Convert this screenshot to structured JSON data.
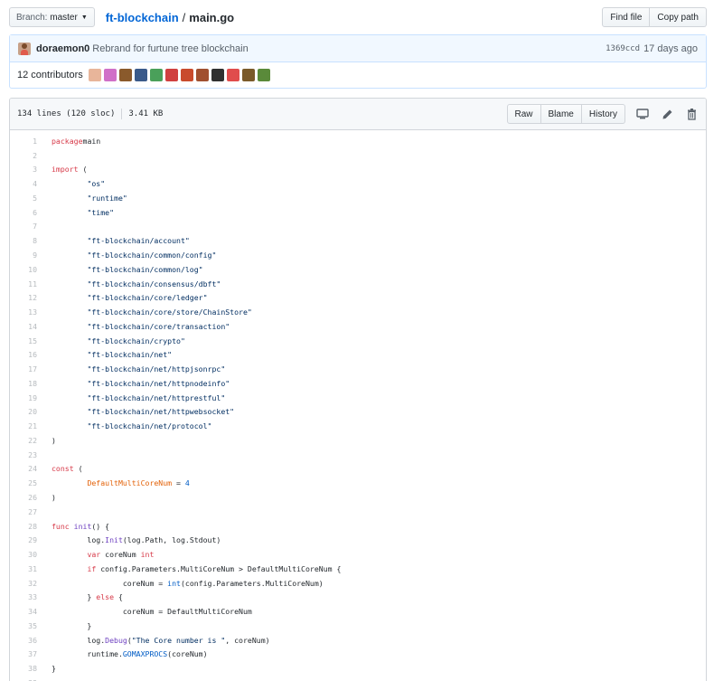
{
  "topbar": {
    "branch_prefix": "Branch:",
    "branch_name": "master",
    "repo_name": "ft-blockchain",
    "separator": "/",
    "file_name": "main.go",
    "find_file_label": "Find file",
    "copy_path_label": "Copy path"
  },
  "commit": {
    "author": "doraemon0",
    "message": "Rebrand for furtune tree blockchain",
    "sha": "1369ccd",
    "age": "17 days ago",
    "contributors_label": "12 contributors",
    "contributor_avatars": [
      "#e8b59a",
      "#d070c8",
      "#8a5a2c",
      "#3a5a8a",
      "#4aa05a",
      "#d04040",
      "#c94b2d",
      "#a05030",
      "#303030",
      "#e04c4c",
      "#7a5a2a",
      "#5a8a3a"
    ]
  },
  "file": {
    "lines_info": "134 lines (120 sloc)",
    "size_info": "3.41 KB",
    "raw_label": "Raw",
    "blame_label": "Blame",
    "history_label": "History",
    "icons": [
      "desktop-icon",
      "pencil-icon",
      "trash-icon"
    ]
  },
  "code_lines": [
    [
      [
        "kw",
        "package"
      ],
      [
        "",
        "main"
      ]
    ],
    [],
    [
      [
        "kw",
        "import"
      ],
      [
        "",
        " ("
      ]
    ],
    [
      [
        "",
        "        "
      ],
      [
        "st",
        "\"os\""
      ]
    ],
    [
      [
        "",
        "        "
      ],
      [
        "st",
        "\"runtime\""
      ]
    ],
    [
      [
        "",
        "        "
      ],
      [
        "st",
        "\"time\""
      ]
    ],
    [],
    [
      [
        "",
        "        "
      ],
      [
        "st",
        "\"ft-blockchain/account\""
      ]
    ],
    [
      [
        "",
        "        "
      ],
      [
        "st",
        "\"ft-blockchain/common/config\""
      ]
    ],
    [
      [
        "",
        "        "
      ],
      [
        "st",
        "\"ft-blockchain/common/log\""
      ]
    ],
    [
      [
        "",
        "        "
      ],
      [
        "st",
        "\"ft-blockchain/consensus/dbft\""
      ]
    ],
    [
      [
        "",
        "        "
      ],
      [
        "st",
        "\"ft-blockchain/core/ledger\""
      ]
    ],
    [
      [
        "",
        "        "
      ],
      [
        "st",
        "\"ft-blockchain/core/store/ChainStore\""
      ]
    ],
    [
      [
        "",
        "        "
      ],
      [
        "st",
        "\"ft-blockchain/core/transaction\""
      ]
    ],
    [
      [
        "",
        "        "
      ],
      [
        "st",
        "\"ft-blockchain/crypto\""
      ]
    ],
    [
      [
        "",
        "        "
      ],
      [
        "st",
        "\"ft-blockchain/net\""
      ]
    ],
    [
      [
        "",
        "        "
      ],
      [
        "st",
        "\"ft-blockchain/net/httpjsonrpc\""
      ]
    ],
    [
      [
        "",
        "        "
      ],
      [
        "st",
        "\"ft-blockchain/net/httpnodeinfo\""
      ]
    ],
    [
      [
        "",
        "        "
      ],
      [
        "st",
        "\"ft-blockchain/net/httprestful\""
      ]
    ],
    [
      [
        "",
        "        "
      ],
      [
        "st",
        "\"ft-blockchain/net/httpwebsocket\""
      ]
    ],
    [
      [
        "",
        "        "
      ],
      [
        "st",
        "\"ft-blockchain/net/protocol\""
      ]
    ],
    [
      [
        "",
        ")"
      ]
    ],
    [],
    [
      [
        "kw",
        "const"
      ],
      [
        "",
        " ("
      ]
    ],
    [
      [
        "",
        "        "
      ],
      [
        "cn",
        "DefaultMultiCoreNum"
      ],
      [
        "",
        " = "
      ],
      [
        "nm",
        "4"
      ]
    ],
    [
      [
        "",
        ")"
      ]
    ],
    [],
    [
      [
        "kw",
        "func"
      ],
      [
        "",
        " "
      ],
      [
        "fn",
        "init"
      ],
      [
        "",
        "() {"
      ]
    ],
    [
      [
        "",
        "        log."
      ],
      [
        "fn",
        "Init"
      ],
      [
        "",
        "(log.Path, log.Stdout)"
      ]
    ],
    [
      [
        "",
        "        "
      ],
      [
        "kw",
        "var"
      ],
      [
        "",
        " coreNum "
      ],
      [
        "kw",
        "int"
      ]
    ],
    [
      [
        "",
        "        "
      ],
      [
        "kw",
        "if"
      ],
      [
        "",
        " config.Parameters.MultiCoreNum > DefaultMultiCoreNum {"
      ]
    ],
    [
      [
        "",
        "                coreNum = "
      ],
      [
        "nm",
        "int"
      ],
      [
        "",
        "(config.Parameters.MultiCoreNum)"
      ]
    ],
    [
      [
        "",
        "        } "
      ],
      [
        "kw",
        "else"
      ],
      [
        "",
        " {"
      ]
    ],
    [
      [
        "",
        "                coreNum = DefaultMultiCoreNum"
      ]
    ],
    [
      [
        "",
        "        }"
      ]
    ],
    [
      [
        "",
        "        log."
      ],
      [
        "fn",
        "Debug"
      ],
      [
        "",
        "("
      ],
      [
        "st",
        "\"The Core number is \""
      ],
      [
        "",
        ", coreNum)"
      ]
    ],
    [
      [
        "",
        "        runtime."
      ],
      [
        "nm",
        "GOMAXPROCS"
      ],
      [
        "",
        "(coreNum)"
      ]
    ],
    [
      [
        "",
        "}"
      ]
    ],
    []
  ]
}
